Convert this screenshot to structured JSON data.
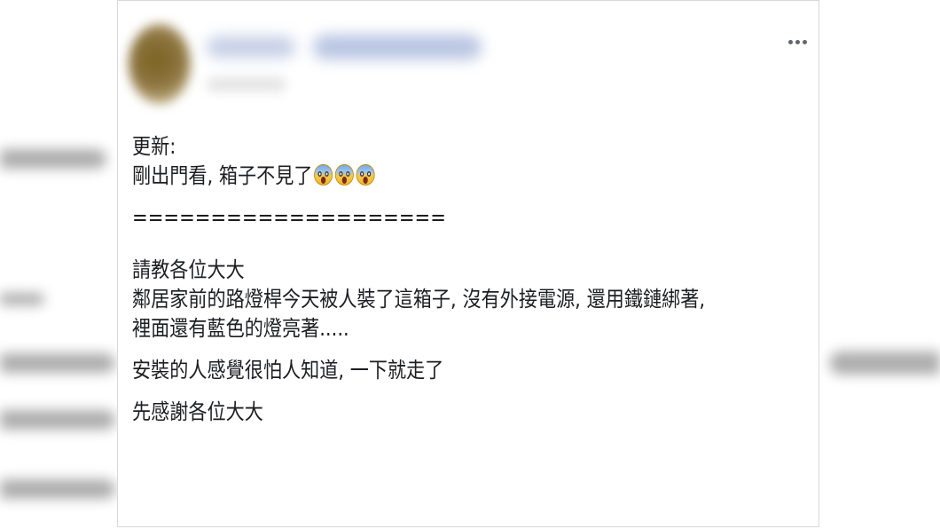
{
  "post": {
    "lines": {
      "update_label": "更新:",
      "update_text": "剛出門看, 箱子不見了",
      "separator": "====================",
      "ask": "請教各位大大",
      "body_1": "鄰居家前的路燈桿今天被人裝了這箱子, 沒有外接電源, 還用鐵鏈綁著,",
      "body_2": "裡面還有藍色的燈亮著.....",
      "body_3": "安裝的人感覺很怕人知道, 一下就走了",
      "thanks": "先感謝各位大大"
    },
    "emojis": [
      "face-screaming-in-fear-icon",
      "face-screaming-in-fear-icon",
      "face-screaming-in-fear-icon"
    ]
  },
  "colors": {
    "text": "#1c1e21",
    "more_icon": "#606770",
    "card_border": "#d8d8d8"
  }
}
